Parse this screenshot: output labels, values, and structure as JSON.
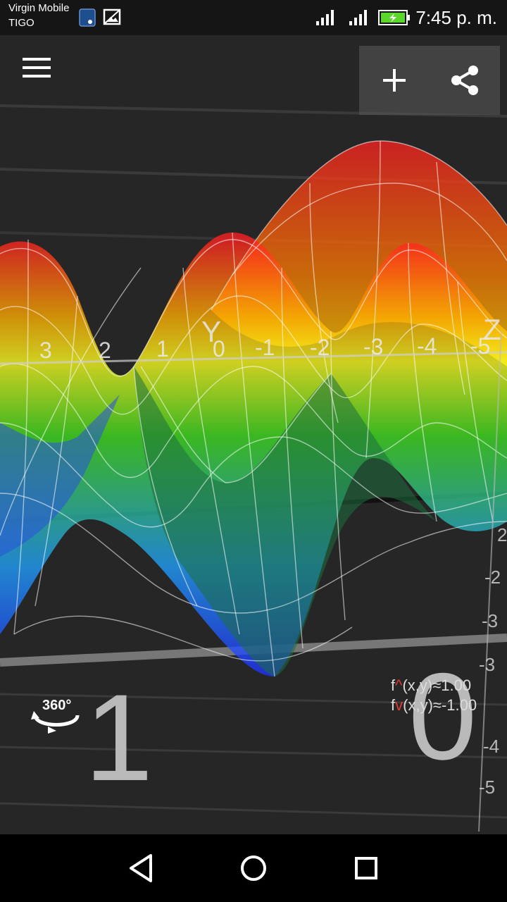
{
  "status_bar": {
    "carrier_primary": "Virgin Mobile",
    "carrier_secondary": "TIGO",
    "time": "7:45 p. m.",
    "icons": [
      "sim-notification-icon",
      "image-notification-icon",
      "signal-icon",
      "signal-icon",
      "battery-charging-icon"
    ]
  },
  "toolbar": {
    "menu_icon": "hamburger-menu-icon",
    "add_icon": "plus-icon",
    "share_icon": "share-icon"
  },
  "plot": {
    "y_axis_label": "Y",
    "z_axis_label": "Z",
    "y_ticks": [
      "3",
      "2",
      "1",
      "0",
      "-1",
      "-2",
      "-3",
      "-4",
      "-5"
    ],
    "z_ticks": [
      "2",
      "-2",
      "-3",
      "-3",
      "-4",
      "-5"
    ],
    "surface_colors": [
      "#ff2020",
      "#ffd800",
      "#ffff20",
      "#40e020",
      "#20c0ff",
      "#2030ff"
    ]
  },
  "overlay": {
    "rotate_label": "360°",
    "digit_left": "1",
    "digit_right": "0",
    "f_max_prefix": "f",
    "f_max_arrow": "^",
    "f_max_suffix": "(x,y)≈1.00",
    "f_min_prefix": "f",
    "f_min_arrow": "v",
    "f_min_suffix": "(x,y)≈-1.00"
  },
  "nav_bar": {
    "back_icon": "back-triangle-icon",
    "home_icon": "home-circle-icon",
    "recents_icon": "recents-square-icon"
  }
}
